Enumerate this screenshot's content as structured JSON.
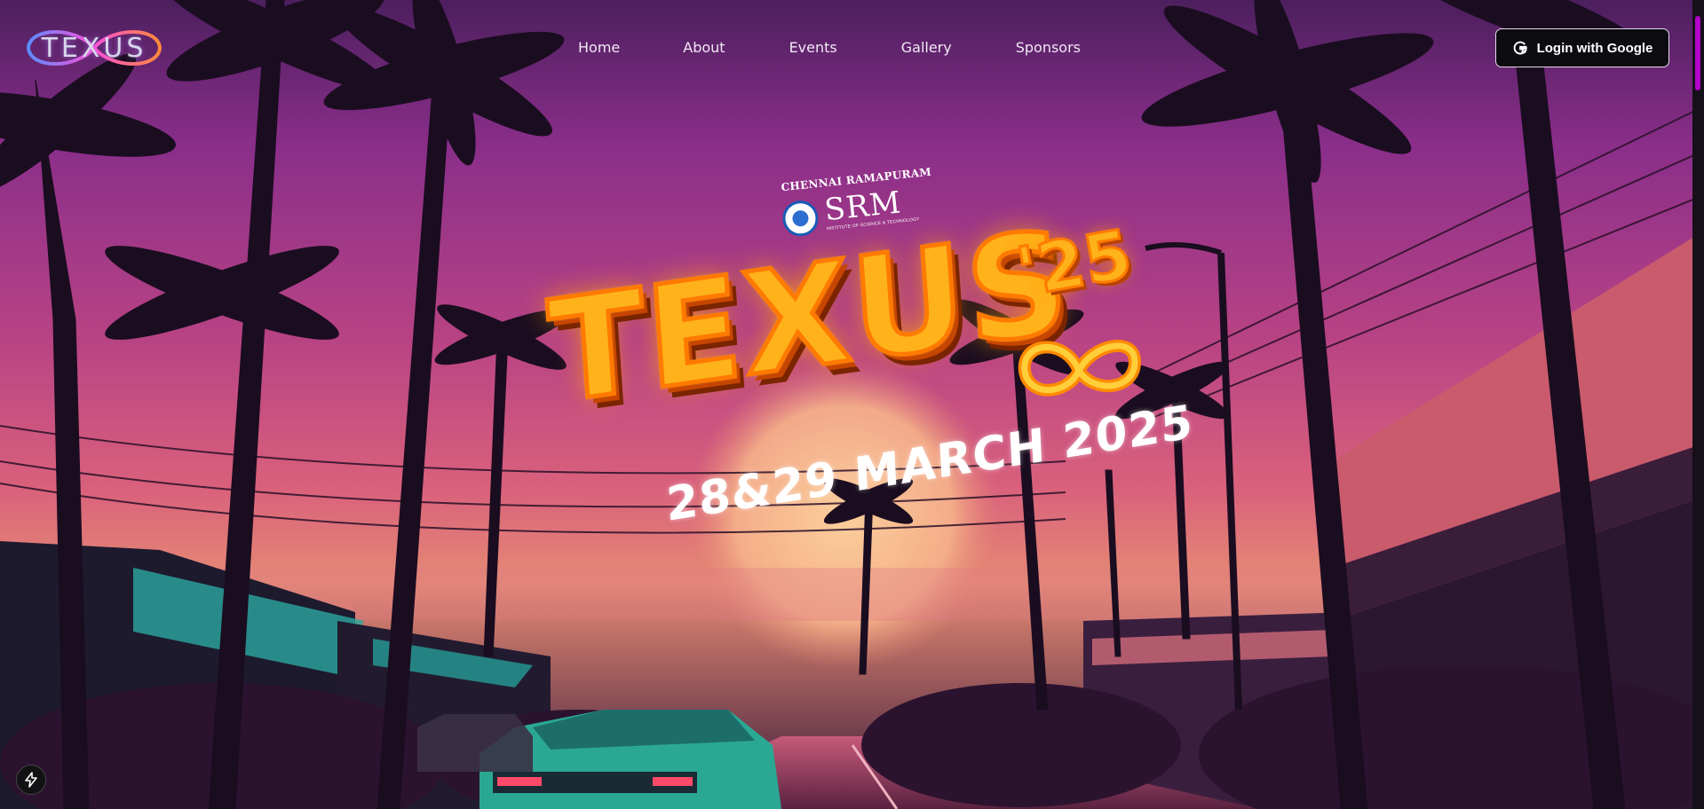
{
  "logo": {
    "text": "TEXUS"
  },
  "nav": {
    "items": [
      "Home",
      "About",
      "Events",
      "Gallery",
      "Sponsors"
    ]
  },
  "auth": {
    "login_label": "Login with Google",
    "icon": "google-g-icon"
  },
  "hero": {
    "institution_top": "CHENNAI RAMAPURAM",
    "institution_name": "SRM",
    "institution_sub": "INSTITUTE OF SCIENCE & TECHNOLOGY",
    "title": "TEXUS",
    "year": "'25",
    "date": "28&29 MARCH 2025"
  },
  "floating_button": {
    "icon": "lightning-bolt-icon"
  },
  "colors": {
    "sky_top": "#7a2d86",
    "sky_mid": "#c74a86",
    "horizon": "#f08a6a",
    "title_fill": "#ffb21a",
    "title_stroke": "#ff7a00",
    "accent": "#b300c8"
  }
}
